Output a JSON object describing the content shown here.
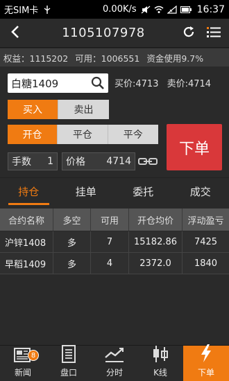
{
  "status_bar": {
    "carrier": "无SIM卡",
    "speed": "0.00K/s",
    "time": "16:37"
  },
  "header": {
    "title": "1105107978"
  },
  "account": {
    "equity": "权益：1115202",
    "available": "可用：1006551",
    "usage": "资金使用9.7%"
  },
  "trade": {
    "symbol": "白糖1409",
    "bid": "买价:4713",
    "ask": "卖价:4714",
    "direction_options": [
      "买入",
      "卖出"
    ],
    "direction_selected": "买入",
    "offset_options": [
      "开仓",
      "平仓",
      "平今"
    ],
    "offset_selected": "开仓",
    "qty_label": "手数",
    "qty_value": "1",
    "price_label": "价格",
    "price_value": "4714",
    "order_button": "下单"
  },
  "tabs": [
    "持仓",
    "挂单",
    "委托",
    "成交"
  ],
  "active_tab": "持仓",
  "positions": {
    "columns": [
      "合约名称",
      "多空",
      "可用",
      "开仓均价",
      "浮动盈亏"
    ],
    "rows": [
      [
        "沪锌1408",
        "多",
        "7",
        "15182.86",
        "7425"
      ],
      [
        "早稻1409",
        "多",
        "4",
        "2372.0",
        "1840"
      ]
    ]
  },
  "bottom_nav": {
    "items": [
      {
        "label": "新闻",
        "icon": "news-icon",
        "badge": "8"
      },
      {
        "label": "盘口",
        "icon": "orderbook-icon"
      },
      {
        "label": "分时",
        "icon": "timeshare-chart-icon"
      },
      {
        "label": "K线",
        "icon": "candlestick-icon"
      },
      {
        "label": "下单",
        "icon": "lightning-icon"
      }
    ],
    "active": "下单"
  },
  "colors": {
    "accent": "#f07b12",
    "order_button": "#d9383a"
  }
}
